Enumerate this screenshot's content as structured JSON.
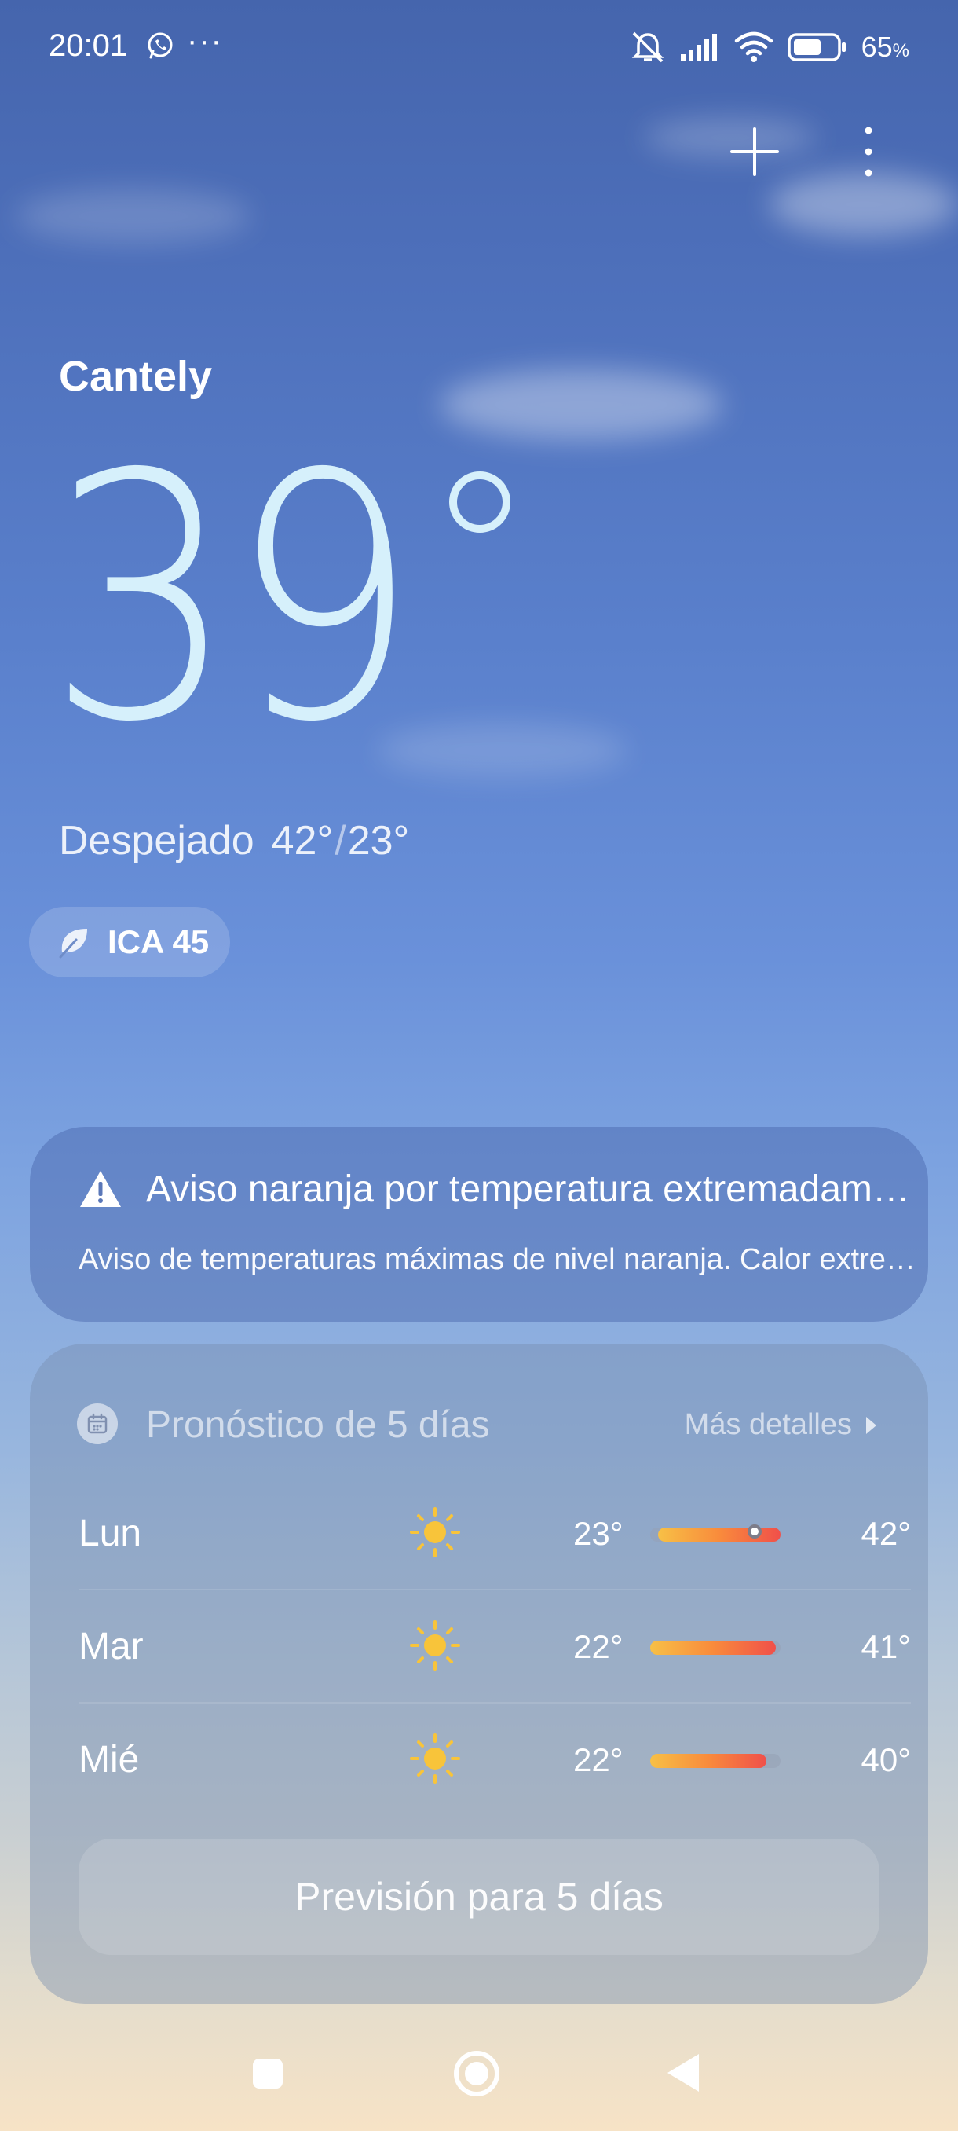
{
  "status_bar": {
    "time": "20:01",
    "overflow": "···",
    "battery_percent": "65",
    "battery_unit": "%",
    "icons": [
      "whatsapp-icon",
      "muted-bell-icon",
      "signal-icon",
      "wifi-icon",
      "battery-icon"
    ]
  },
  "header": {
    "add_icon": "plus-icon",
    "more_icon": "more-vertical-icon"
  },
  "current": {
    "city": "Cantely",
    "temperature": "39",
    "condition": "Despejado",
    "high": "42°",
    "separator": "/",
    "low": "23°",
    "aqi_label": "ICA 45",
    "aqi_icon": "leaf-icon"
  },
  "alert": {
    "icon": "warning-icon",
    "title": "Aviso naranja por temperatura extremadamente alta",
    "text": "Aviso de temperaturas máximas de nivel naranja. Calor extremo"
  },
  "forecast": {
    "title": "Pronóstico de 5 días",
    "more_label": "Más detalles",
    "days": [
      {
        "day": "Lun",
        "icon": "sun-icon",
        "low": "23°",
        "high": "42°",
        "current": "39°"
      },
      {
        "day": "Mar",
        "icon": "sun-icon",
        "low": "22°",
        "high": "41°"
      },
      {
        "day": "Mié",
        "icon": "sun-icon",
        "low": "22°",
        "high": "40°"
      }
    ],
    "button_label": "Previsión para 5 días"
  },
  "colors": {
    "sky_top": "#4565ad",
    "sky_bottom": "#f7e3c6",
    "temp_text": "#d6f0fb",
    "sun": "#f8c43a",
    "bar_start": "#f7c046",
    "bar_end": "#f0504a"
  }
}
